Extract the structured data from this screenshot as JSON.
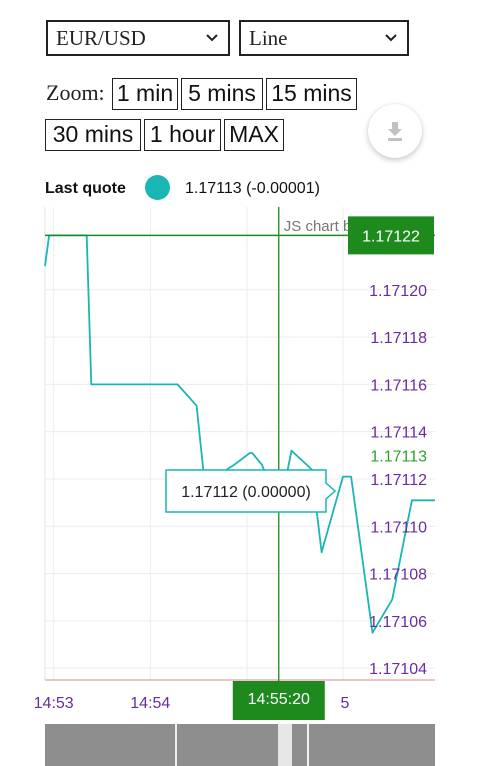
{
  "controls": {
    "instrument": "EUR/USD",
    "chart_type": "Line",
    "zoom_label": "Zoom:",
    "zoom_buttons": [
      "1 min",
      "5 mins",
      "15 mins",
      "30 mins",
      "1 hour",
      "MAX"
    ],
    "download_icon": "download-icon"
  },
  "last_quote": {
    "label": "Last quote",
    "value": "1.17113 (-0.00001)",
    "dot_color": "#19b6b3"
  },
  "chart_data": {
    "type": "line",
    "credit": "JS chart by amCharts",
    "x_ticks": [
      "14:53",
      "14:54",
      "5"
    ],
    "y_ticks": [
      "1.17120",
      "1.17118",
      "1.17116",
      "1.17114",
      "1.17113",
      "1.17112",
      "1.17110",
      "1.17108",
      "1.17106",
      "1.17104"
    ],
    "y_tick_values": [
      1.1712,
      1.17118,
      1.17116,
      1.17114,
      1.17113,
      1.17112,
      1.1711,
      1.17108,
      1.17106,
      1.17104
    ],
    "ylim": [
      1.171035,
      1.171235
    ],
    "series": [
      {
        "color": "#19b6b3",
        "x": [
          14.8818,
          14.8825,
          14.889,
          14.8898,
          14.9047,
          14.908,
          14.9094,
          14.9145,
          14.9172,
          14.9176,
          14.9193,
          14.9201,
          14.9235,
          14.9244,
          14.9279,
          14.9296,
          14.9333,
          14.9347,
          14.9384,
          14.9418,
          14.9452,
          14.9492
        ],
        "values": [
          1.17121,
          1.171223,
          1.171223,
          1.17116,
          1.17116,
          1.171151,
          1.171118,
          1.171126,
          1.171131,
          1.171131,
          1.171126,
          1.171121,
          1.171121,
          1.171132,
          1.171124,
          1.171089,
          1.171121,
          1.171121,
          1.171055,
          1.171069,
          1.171111,
          1.171111
        ]
      }
    ],
    "price_line": {
      "value": 1.171223,
      "label": "1.17122",
      "color": "#1e8a1e"
    },
    "last_price_marker": {
      "value": 1.17113,
      "color": "#2aa52a"
    },
    "cursor": {
      "x": 14.9222,
      "time_label": "14:55:20",
      "color": "#1e8a1e"
    },
    "tooltip": "1.17112 (0.00000)",
    "baseline_color": "#e8a0a0",
    "grid": true
  }
}
